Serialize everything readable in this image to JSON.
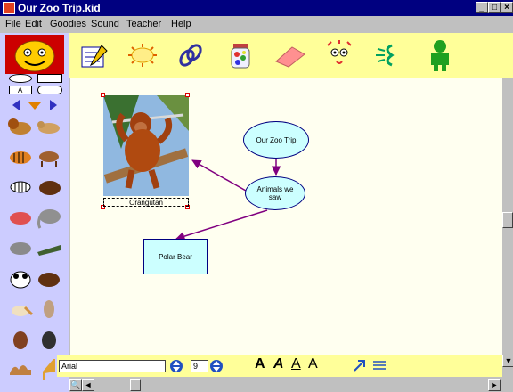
{
  "window": {
    "title": "Our Zoo Trip.kid",
    "min_label": "_",
    "max_label": "□",
    "close_label": "×"
  },
  "menu": [
    {
      "label": "File"
    },
    {
      "label": "Edit"
    },
    {
      "label": "Goodies"
    },
    {
      "label": "Sound"
    },
    {
      "label": "Teacher"
    },
    {
      "label": "Help"
    }
  ],
  "toolbar": {
    "tools": [
      {
        "name": "notepad-icon"
      },
      {
        "name": "sun-icon"
      },
      {
        "name": "chain-link-icon"
      },
      {
        "name": "jar-icon"
      },
      {
        "name": "eraser-icon"
      },
      {
        "name": "face-icon"
      },
      {
        "name": "hearing-icon"
      },
      {
        "name": "person-icon"
      }
    ]
  },
  "diagram": {
    "nodes": [
      {
        "id": "n1",
        "label": "Our Zoo Trip",
        "shape": "oval"
      },
      {
        "id": "n2",
        "label": "Animals we saw",
        "shape": "oval"
      },
      {
        "id": "n3",
        "label": "Polar Bear",
        "shape": "rect"
      }
    ],
    "image_caption": "Orangutan"
  },
  "fontbar": {
    "font_name": "Arial",
    "font_size": "9"
  },
  "colors": {
    "toolbar": "#ffff99",
    "palette": "#ccccff",
    "canvas": "#fffff0",
    "node_fill": "#ccffff",
    "arrow": "#800080"
  }
}
